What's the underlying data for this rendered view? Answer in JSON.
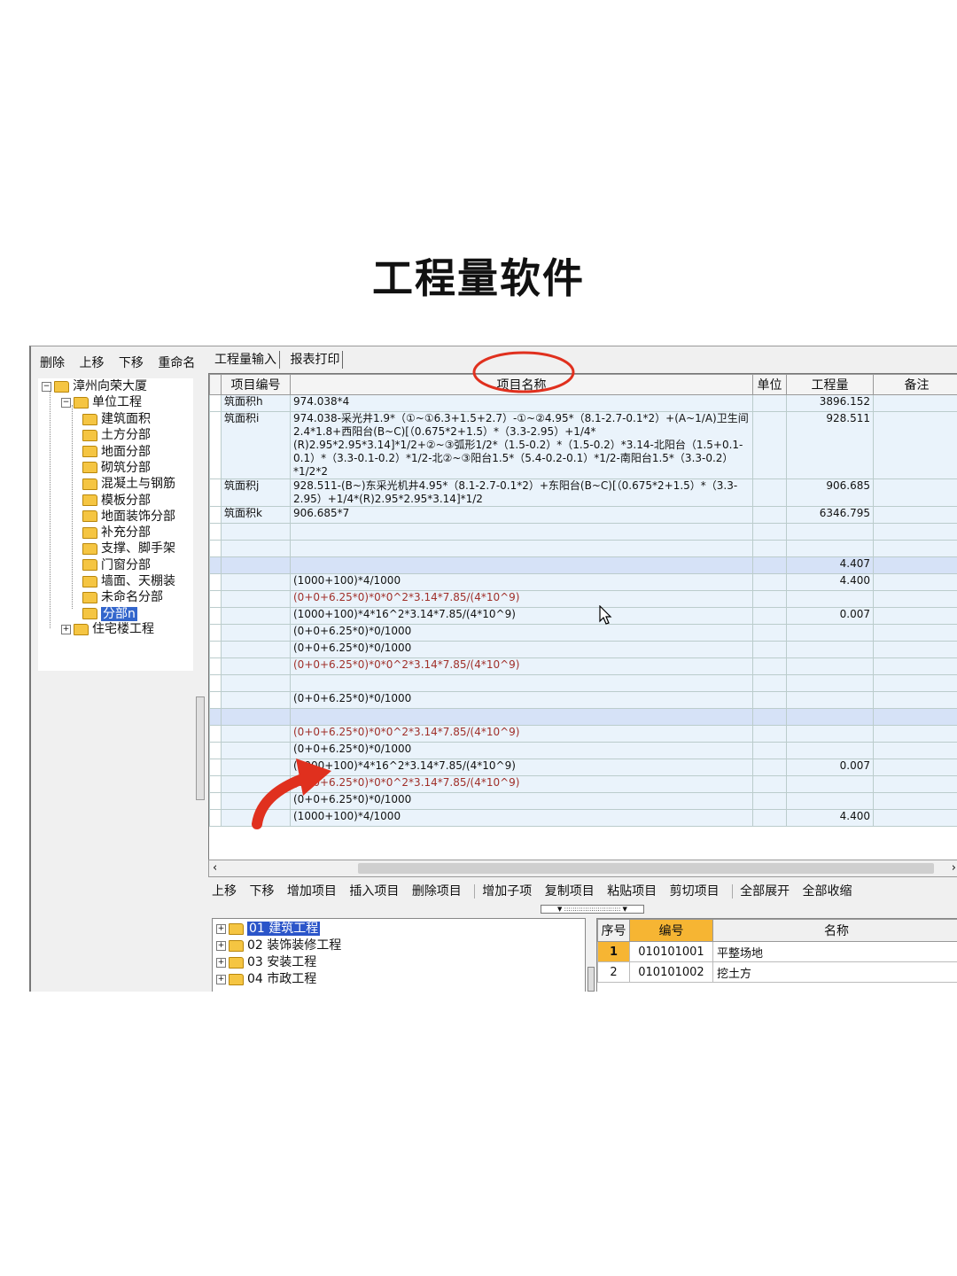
{
  "headline": "工程量软件",
  "left_toolbar": [
    "删除",
    "上移",
    "下移",
    "重命名"
  ],
  "tree": {
    "root": "漳州向荣大厦",
    "unit": "单位工程",
    "children": [
      "建筑面积",
      "土方分部",
      "地面分部",
      "砌筑分部",
      "混凝土与钢筋",
      "模板分部",
      "地面装饰分部",
      "补充分部",
      "支撑、脚手架",
      "门窗分部",
      "墙面、天棚装",
      "未命名分部",
      "分部n"
    ],
    "sibling": "住宅楼工程"
  },
  "tabs": [
    "工程量输入",
    "报表打印"
  ],
  "grid": {
    "headers": [
      "项目编号",
      "项目名称",
      "单位",
      "工程量",
      "备注"
    ],
    "rows": [
      {
        "code": "筑面积h",
        "name": "974.038*4",
        "qty": "3896.152"
      },
      {
        "code": "筑面积i",
        "name": "974.038-采光井1.9*（①~①6.3+1.5+2.7）-①~②4.95*（8.1-2.7-0.1*2）+(A~1/A)卫生间2.4*1.8+西阳台(B~C)[（0.675*2+1.5）*（3.3-2.95）+1/4*(R)2.95*2.95*3.14]*1/2+②~③弧形1/2*（1.5-0.2）*（1.5-0.2）*3.14-北阳台（1.5+0.1-0.1）*（3.3-0.1-0.2）*1/2-北②~③阳台1.5*（5.4-0.2-0.1）*1/2-南阳台1.5*（3.3-0.2）*1/2*2",
        "qty": "928.511"
      },
      {
        "code": "筑面积j",
        "name": "928.511-(B~)东采光机井4.95*（8.1-2.7-0.1*2）+东阳台(B~C)[（0.675*2+1.5）*（3.3-2.95）+1/4*(R)2.95*2.95*3.14]*1/2",
        "qty": "906.685"
      },
      {
        "code": "筑面积k",
        "name": "906.685*7",
        "qty": "6346.795"
      },
      {
        "code": "",
        "name": "",
        "qty": ""
      },
      {
        "code": "",
        "name": "",
        "qty": ""
      },
      {
        "code": "",
        "name": "",
        "qty": "4.407",
        "hl": true
      },
      {
        "code": "",
        "name": "(1000+100)*4/1000",
        "qty": "4.400"
      },
      {
        "code": "",
        "name": "(0+0+6.25*0)*0*0^2*3.14*7.85/(4*10^9)",
        "qty": "",
        "red": true
      },
      {
        "code": "",
        "name": "(1000+100)*4*16^2*3.14*7.85/(4*10^9)",
        "qty": "0.007"
      },
      {
        "code": "",
        "name": "(0+0+6.25*0)*0/1000",
        "qty": ""
      },
      {
        "code": "",
        "name": "(0+0+6.25*0)*0/1000",
        "qty": ""
      },
      {
        "code": "",
        "name": "(0+0+6.25*0)*0*0^2*3.14*7.85/(4*10^9)",
        "qty": "",
        "red": true
      },
      {
        "code": "",
        "name": "",
        "qty": ""
      },
      {
        "code": "",
        "name": "(0+0+6.25*0)*0/1000",
        "qty": ""
      },
      {
        "code": "",
        "name": "",
        "qty": "",
        "hl": true
      },
      {
        "code": "",
        "name": "(0+0+6.25*0)*0*0^2*3.14*7.85/(4*10^9)",
        "qty": "",
        "red": true
      },
      {
        "code": "",
        "name": "(0+0+6.25*0)*0/1000",
        "qty": ""
      },
      {
        "code": "",
        "name": "(1000+100)*4*16^2*3.14*7.85/(4*10^9)",
        "qty": "0.007"
      },
      {
        "code": "",
        "name": "(0+0+6.25*0)*0*0^2*3.14*7.85/(4*10^9)",
        "qty": "",
        "red": true
      },
      {
        "code": "",
        "name": "(0+0+6.25*0)*0/1000",
        "qty": ""
      },
      {
        "code": "",
        "name": "(1000+100)*4/1000",
        "qty": "4.400"
      }
    ]
  },
  "button_bar": [
    "上移",
    "下移",
    "增加项目",
    "插入项目",
    "删除项目",
    "增加子项",
    "复制项目",
    "粘贴项目",
    "剪切项目",
    "全部展开",
    "全部收缩"
  ],
  "bottom_tree": [
    {
      "num": "01",
      "label": "建筑工程",
      "selected": true
    },
    {
      "num": "02",
      "label": "装饰装修工程"
    },
    {
      "num": "03",
      "label": "安装工程"
    },
    {
      "num": "04",
      "label": "市政工程"
    }
  ],
  "bottom_table": {
    "headers": [
      "序号",
      "编号",
      "名称"
    ],
    "rows": [
      {
        "seq": "1",
        "code": "010101001",
        "name": "平整场地"
      },
      {
        "seq": "2",
        "code": "010101002",
        "name": "挖土方"
      }
    ]
  },
  "colors": {
    "annotation_red": "#e0301e",
    "selection_blue": "#3366cc",
    "header_orange": "#f6b533"
  }
}
